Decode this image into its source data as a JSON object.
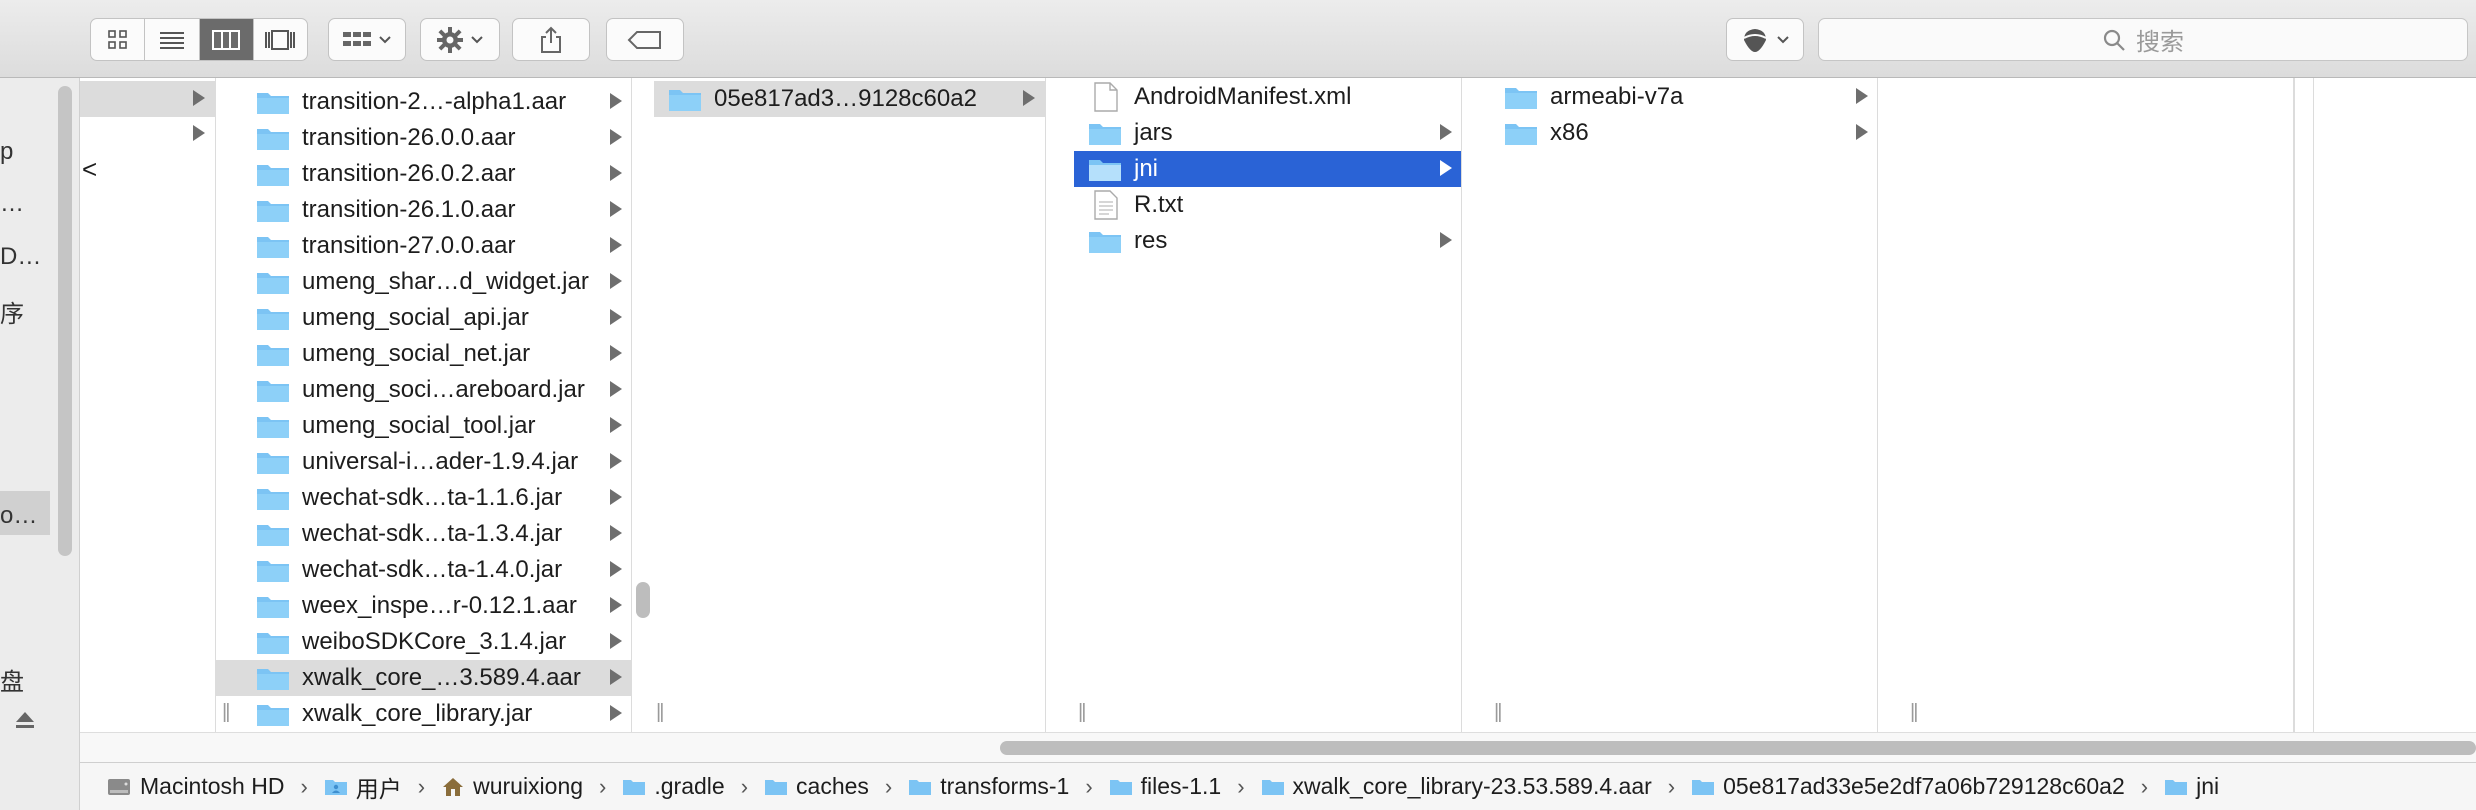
{
  "window": {
    "title": ""
  },
  "search": {
    "placeholder": "搜索"
  },
  "sidebar": {
    "items": [
      "p",
      "…",
      "D…",
      "序",
      "o…",
      "盘"
    ]
  },
  "colors": {
    "selection": "#2a63d6",
    "folder": "#7cc4f4",
    "folder_dark": "#5aa9e6"
  },
  "columns": {
    "col1": {
      "items": [
        {
          "label": ""
        },
        {
          "label": ""
        }
      ],
      "extra": "<"
    },
    "col2": {
      "items": [
        {
          "label": "transition-2…-alpha1.aar"
        },
        {
          "label": "transition-26.0.0.aar"
        },
        {
          "label": "transition-26.0.2.aar"
        },
        {
          "label": "transition-26.1.0.aar"
        },
        {
          "label": "transition-27.0.0.aar"
        },
        {
          "label": "umeng_shar…d_widget.jar"
        },
        {
          "label": "umeng_social_api.jar"
        },
        {
          "label": "umeng_social_net.jar"
        },
        {
          "label": "umeng_soci…areboard.jar"
        },
        {
          "label": "umeng_social_tool.jar"
        },
        {
          "label": "universal-i…ader-1.9.4.jar"
        },
        {
          "label": "wechat-sdk…ta-1.1.6.jar"
        },
        {
          "label": "wechat-sdk…ta-1.3.4.jar"
        },
        {
          "label": "wechat-sdk…ta-1.4.0.jar"
        },
        {
          "label": "weex_inspe…r-0.12.1.aar"
        },
        {
          "label": "weiboSDKCore_3.1.4.jar"
        },
        {
          "label": "xwalk_core_…3.589.4.aar"
        },
        {
          "label": "xwalk_core_library.jar"
        }
      ]
    },
    "col3": {
      "items": [
        {
          "label": "05e817ad3…9128c60a2"
        }
      ]
    },
    "col4": {
      "items": [
        {
          "label": "AndroidManifest.xml"
        },
        {
          "label": "jars"
        },
        {
          "label": "jni"
        },
        {
          "label": "R.txt"
        },
        {
          "label": "res"
        }
      ]
    },
    "col5": {
      "items": [
        {
          "label": "armeabi-v7a"
        },
        {
          "label": "x86"
        }
      ]
    }
  },
  "pathbar": {
    "items": [
      "Macintosh HD",
      "用户",
      "wuruixiong",
      ".gradle",
      "caches",
      "transforms-1",
      "files-1.1",
      "xwalk_core_library-23.53.589.4.aar",
      "05e817ad33e5e2df7a06b729128c60a2",
      "jni"
    ]
  }
}
